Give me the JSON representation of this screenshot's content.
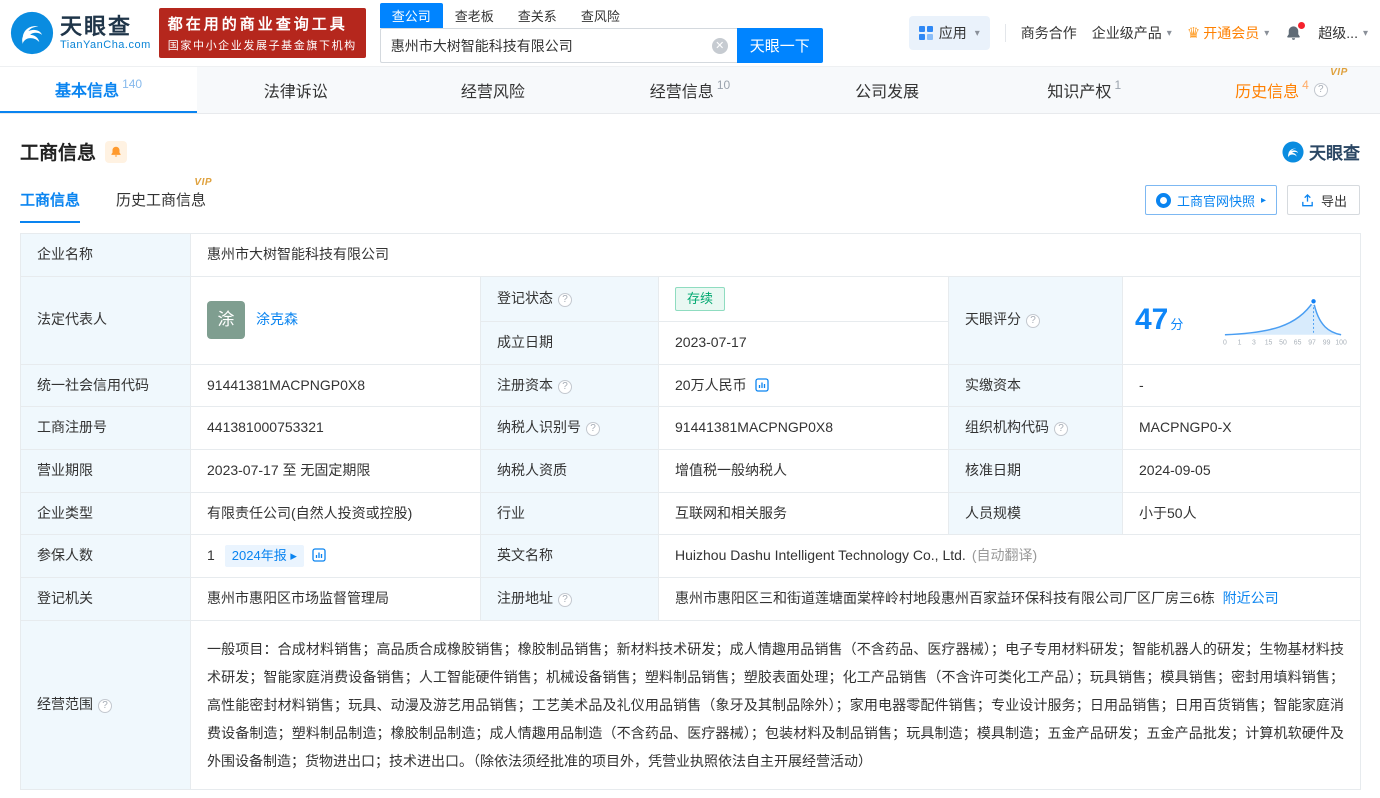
{
  "header": {
    "logo": {
      "brand": "天眼查",
      "domain": "TianYanCha.com"
    },
    "promo": {
      "line1": "都在用的商业查询工具",
      "line2": "国家中小企业发展子基金旗下机构"
    },
    "search": {
      "tabs": [
        {
          "label": "查公司"
        },
        {
          "label": "查老板"
        },
        {
          "label": "查关系"
        },
        {
          "label": "查风险"
        }
      ],
      "value": "惠州市大树智能科技有限公司",
      "button": "天眼一下"
    },
    "menu": {
      "apps": "应用",
      "coop": "商务合作",
      "enterprise": "企业级产品",
      "vip": "开通会员",
      "super": "超级..."
    }
  },
  "nav": {
    "tabs": [
      {
        "label": "基本信息",
        "count": "140"
      },
      {
        "label": "法律诉讼"
      },
      {
        "label": "经营风险"
      },
      {
        "label": "经营信息",
        "count": "10"
      },
      {
        "label": "公司发展"
      },
      {
        "label": "知识产权",
        "count": "1"
      },
      {
        "label": "历史信息",
        "count": "4",
        "vip": "VIP"
      }
    ]
  },
  "section": {
    "title": "工商信息",
    "watermark": "天眼查",
    "tabs": [
      {
        "label": "工商信息"
      },
      {
        "label": "历史工商信息",
        "vip": "VIP"
      }
    ],
    "snapshot_button": "工商官网快照",
    "export_button": "导出"
  },
  "fields": {
    "company_name_label": "企业名称",
    "company_name": "惠州市大树智能科技有限公司",
    "legal_rep_label": "法定代表人",
    "legal_rep_avatar": "涂",
    "legal_rep_name": "涂克森",
    "reg_status_label": "登记状态",
    "reg_status": "存续",
    "establish_date_label": "成立日期",
    "establish_date": "2023-07-17",
    "score_label": "天眼评分",
    "score_value": "47",
    "score_unit": "分",
    "uscc_label": "统一社会信用代码",
    "uscc": "91441381MACPNGP0X8",
    "reg_capital_label": "注册资本",
    "reg_capital": "20万人民币",
    "paid_capital_label": "实缴资本",
    "paid_capital": "-",
    "reg_no_label": "工商注册号",
    "reg_no": "441381000753321",
    "taxpayer_id_label": "纳税人识别号",
    "taxpayer_id": "91441381MACPNGP0X8",
    "org_code_label": "组织机构代码",
    "org_code": "MACPNGP0-X",
    "business_term_label": "营业期限",
    "business_term": "2023-07-17 至 无固定期限",
    "taxpayer_qual_label": "纳税人资质",
    "taxpayer_qual": "增值税一般纳税人",
    "approval_date_label": "核准日期",
    "approval_date": "2024-09-05",
    "company_type_label": "企业类型",
    "company_type": "有限责任公司(自然人投资或控股)",
    "industry_label": "行业",
    "industry": "互联网和相关服务",
    "staff_size_label": "人员规模",
    "staff_size": "小于50人",
    "insured_label": "参保人数",
    "insured_count": "1",
    "insured_report_link": "2024年报 ▸",
    "english_name_label": "英文名称",
    "english_name": "Huizhou Dashu Intelligent Technology Co., Ltd.",
    "english_name_note": "(自动翻译)",
    "reg_authority_label": "登记机关",
    "reg_authority": "惠州市惠阳区市场监督管理局",
    "reg_address_label": "注册地址",
    "reg_address": "惠州市惠阳区三和街道莲塘面棠梓岭村地段惠州百家益环保科技有限公司厂区厂房三6栋",
    "nearby_link": "附近公司",
    "business_scope_label": "经营范围",
    "business_scope": "一般项目：合成材料销售；高品质合成橡胶销售；橡胶制品销售；新材料技术研发；成人情趣用品销售（不含药品、医疗器械）；电子专用材料研发；智能机器人的研发；生物基材料技术研发；智能家庭消费设备销售；人工智能硬件销售；机械设备销售；塑料制品销售；塑胶表面处理；化工产品销售（不含许可类化工产品）；玩具销售；模具销售；密封用填料销售；高性能密封材料销售；玩具、动漫及游艺用品销售；工艺美术品及礼仪用品销售（象牙及其制品除外）；家用电器零配件销售；专业设计服务；日用品销售；日用百货销售；智能家庭消费设备制造；塑料制品制造；橡胶制品制造；成人情趣用品制造（不含药品、医疗器械）；包装材料及制品销售；玩具制造；模具制造；五金产品研发；五金产品批发；计算机软硬件及外围设备制造；货物进出口；技术进出口。（除依法须经批准的项目外，凭营业执照依法自主开展经营活动）"
  },
  "score_chart": {
    "ticks": [
      "0",
      "1",
      "3",
      "15",
      "50",
      "65",
      "97",
      "99",
      "100"
    ]
  }
}
